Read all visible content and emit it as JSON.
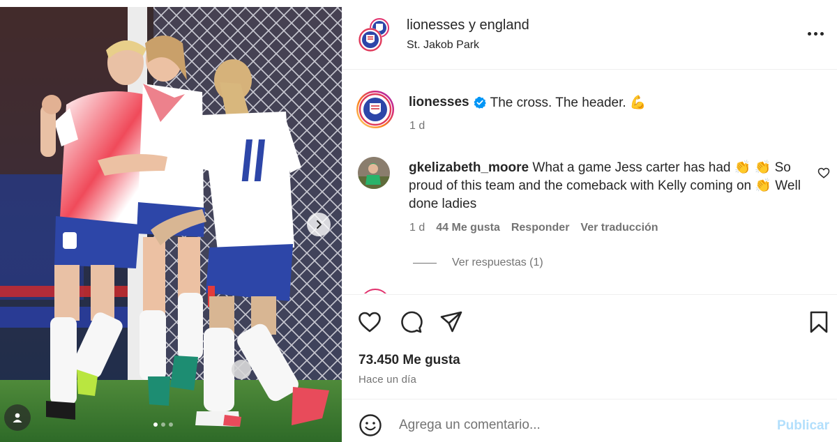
{
  "post": {
    "header": {
      "names_primary": "lionesses",
      "names_joiner": " y ",
      "names_secondary": "england",
      "location": "St. Jakob Park"
    },
    "caption": {
      "username": "lionesses",
      "text": "The cross. The header. 💪",
      "time": "1 d"
    },
    "comment": {
      "username": "gkelizabeth_moore",
      "text": " What a game Jess carter has had 👏 👏 So proud of this team and the comeback with Kelly coming on 👏 Well done ladies",
      "time": "1 d",
      "likes": "44 Me gusta",
      "reply": "Responder",
      "translate": "Ver traducción",
      "view_replies": "Ver respuestas (1)"
    },
    "likes_count": "73.450 Me gusta",
    "posted_when": "Hace un día",
    "composer": {
      "placeholder": "Agrega un comentario...",
      "publish": "Publicar"
    },
    "carousel": {
      "total": 3,
      "active": 1
    },
    "jersey_number": "11"
  },
  "icons": {
    "verified": "verified-badge-icon",
    "more": "more-options-icon",
    "heart": "heart-icon",
    "comment": "comment-icon",
    "share": "share-icon",
    "save": "bookmark-icon",
    "emoji": "emoji-icon",
    "next": "chevron-right-icon",
    "user_tag": "user-tag-icon"
  },
  "colors": {
    "verified": "#0095f6",
    "publish_disabled": "#b2dffc",
    "secondary_text": "#737373",
    "brand_red": "#e1306c"
  }
}
